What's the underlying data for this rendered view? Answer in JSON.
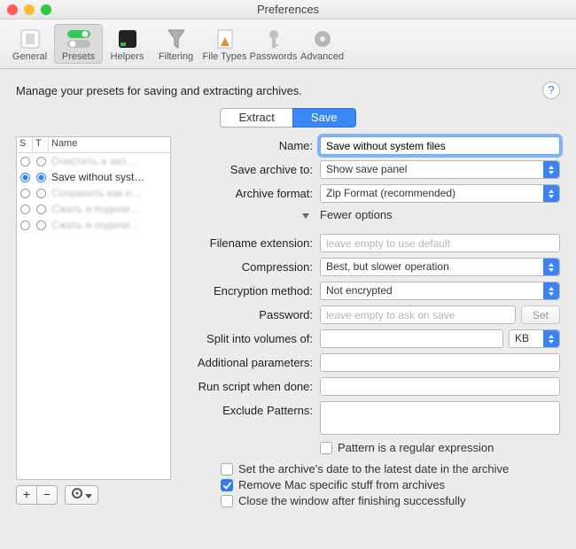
{
  "window": {
    "title": "Preferences"
  },
  "toolbar": [
    {
      "label": "General"
    },
    {
      "label": "Presets"
    },
    {
      "label": "Helpers"
    },
    {
      "label": "Filtering"
    },
    {
      "label": "File Types"
    },
    {
      "label": "Passwords"
    },
    {
      "label": "Advanced"
    }
  ],
  "description": "Manage your presets for saving and extracting archives.",
  "tabs": {
    "extract": "Extract",
    "save": "Save"
  },
  "list": {
    "headers": {
      "s": "S",
      "t": "T",
      "name": "Name"
    },
    "rows": [
      {
        "s": false,
        "t": false,
        "name": "Очистить и зап…",
        "blur": true
      },
      {
        "s": true,
        "t": true,
        "name": "Save without syst…",
        "blur": false
      },
      {
        "s": false,
        "t": false,
        "name": "Сохранить как е…",
        "blur": true
      },
      {
        "s": false,
        "t": false,
        "name": "Сжать и подели…",
        "blur": true
      },
      {
        "s": false,
        "t": false,
        "name": "Сжать и подели…",
        "blur": true
      }
    ]
  },
  "buttons": {
    "add": "+",
    "remove": "−"
  },
  "form": {
    "name_label": "Name:",
    "name_value": "Save without system files",
    "saveto_label": "Save archive to:",
    "saveto_value": "Show save panel",
    "format_label": "Archive format:",
    "format_value": "Zip Format (recommended)",
    "fewer_options": "Fewer options",
    "ext_label": "Filename extension:",
    "ext_placeholder": "leave empty to use default",
    "compression_label": "Compression:",
    "compression_value": "Best, but slower operation",
    "encryption_label": "Encryption method:",
    "encryption_value": "Not encrypted",
    "password_label": "Password:",
    "password_placeholder": "leave empty to ask on save",
    "set_button": "Set",
    "split_label": "Split into volumes of:",
    "split_unit": "KB",
    "params_label": "Additional parameters:",
    "script_label": "Run script when done:",
    "exclude_label": "Exclude Patterns:",
    "regex_label": "Pattern is a regular expression",
    "chk_date": "Set the archive's date to the latest date in the archive",
    "chk_macstuff": "Remove Mac specific stuff from archives",
    "chk_close": "Close the window after finishing successfully"
  },
  "help": "?"
}
